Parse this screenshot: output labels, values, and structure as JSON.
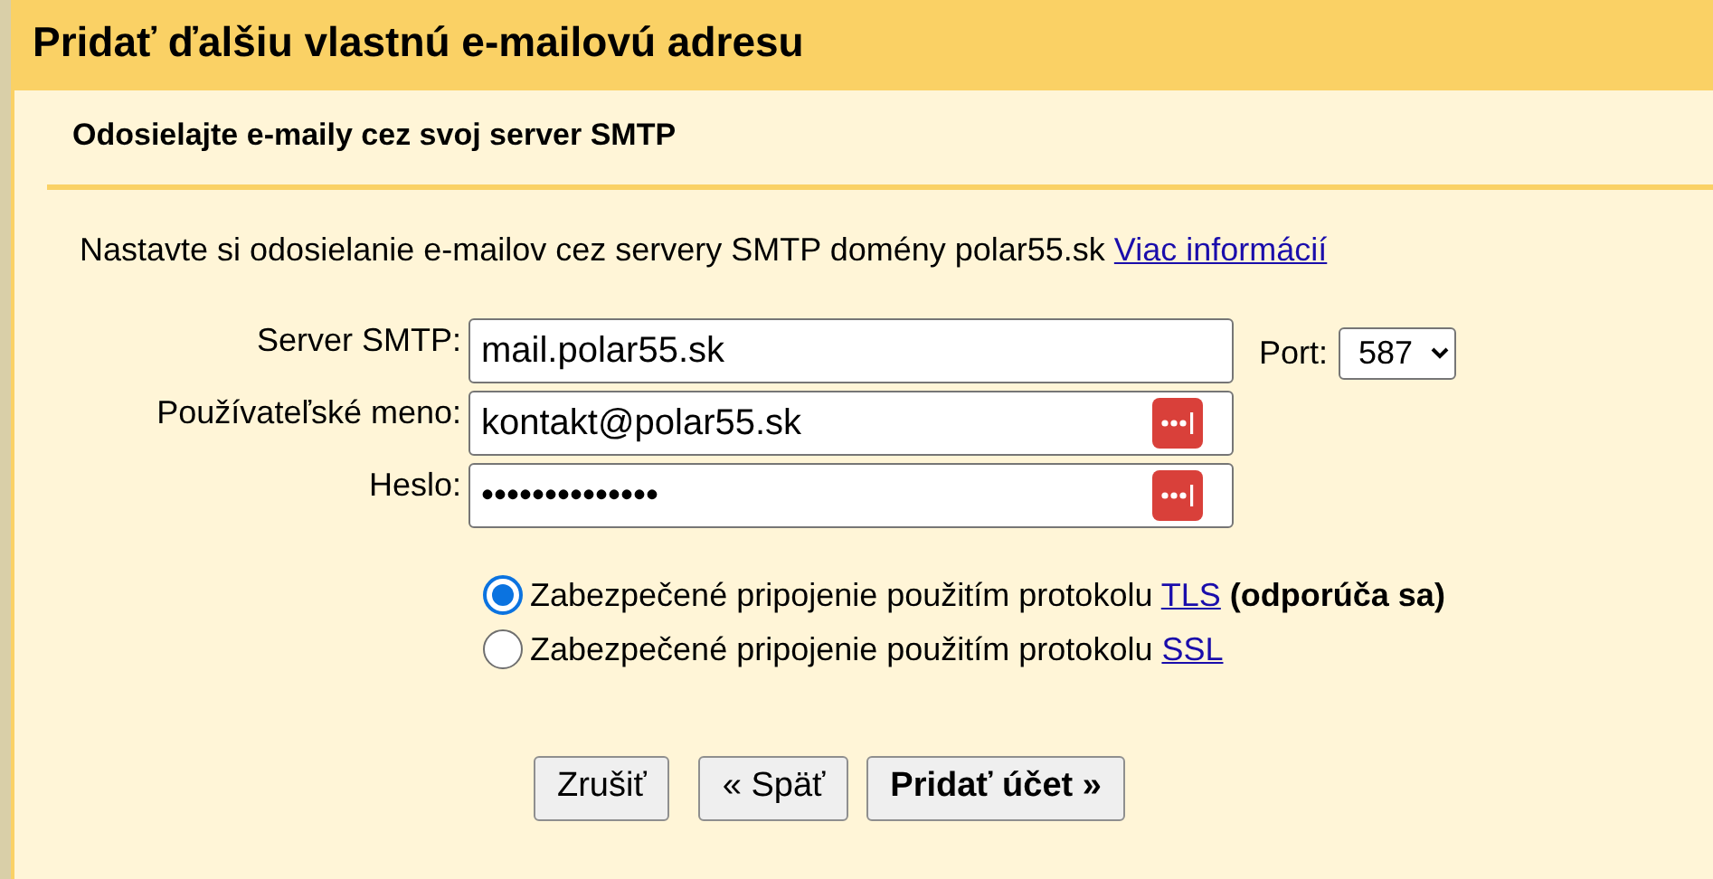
{
  "window": {
    "title": "Pridať ďalšiu vlastnú e-mailovú adresu"
  },
  "section": {
    "heading": "Odosielajte e-maily cez svoj server SMTP"
  },
  "intro": {
    "text": "Nastavte si odosielanie e-mailov cez servery SMTP domény polar55.sk",
    "link": "Viac informácií"
  },
  "fields": [
    {
      "label": "Server SMTP:",
      "value": "mail.polar55.sk",
      "manager_icon": false
    },
    {
      "label": "Používateľské meno:",
      "value": "kontakt@polar55.sk",
      "manager_icon": true
    },
    {
      "label": "Heslo:",
      "value": "••••••••••••••",
      "manager_icon": true
    }
  ],
  "port": {
    "label": "Port:",
    "value": "587"
  },
  "security": [
    {
      "text": "Zabezpečené pripojenie použitím protokolu",
      "link": "TLS",
      "note": "(odporúča sa)",
      "selected": true
    },
    {
      "text": "Zabezpečené pripojenie použitím protokolu",
      "link": "SSL",
      "selected": false
    }
  ],
  "buttons": [
    {
      "label": "Zrušiť",
      "primary": false
    },
    {
      "label": "« Späť",
      "primary": false
    },
    {
      "label": "Pridať účet »",
      "primary": true
    }
  ]
}
